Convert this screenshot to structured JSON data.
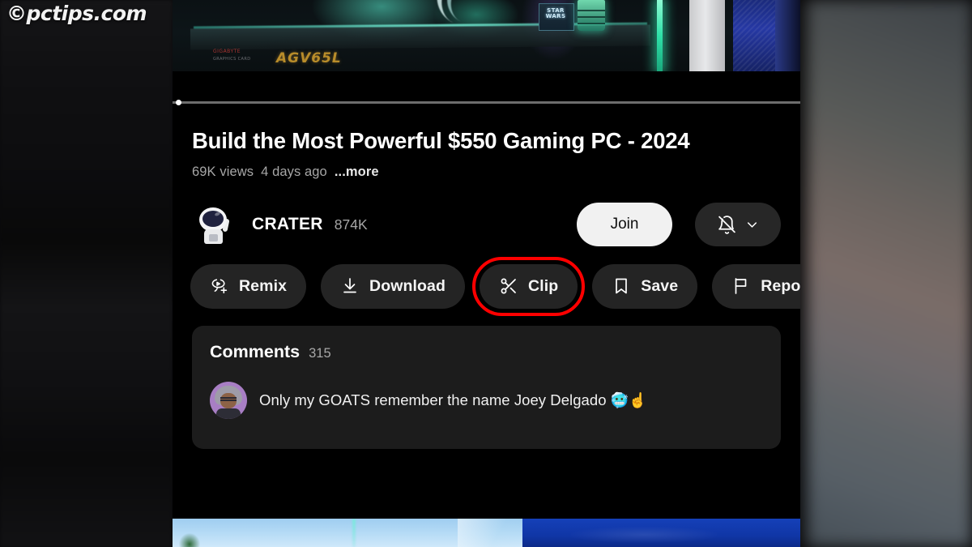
{
  "watermark": {
    "text": "©pctips.com"
  },
  "player": {
    "scrubber": {
      "name": "video-progress-bar",
      "position_percent": 1
    },
    "frame": {
      "gpu_brand": "GIGABYTE",
      "gpu_sub": "GRAPHICS CARD",
      "gpu_model": "AGV65L",
      "box_label": "STAR WARS"
    }
  },
  "video": {
    "title": "Build the Most Powerful $550 Gaming PC - 2024",
    "views": "69K views",
    "published": "4 days ago",
    "more_label": "...more"
  },
  "channel": {
    "avatar_name": "astronaut-avatar",
    "name": "CRATER",
    "subscribers": "874K",
    "join_label": "Join",
    "bell_icon": "bell-off-icon",
    "chevron_icon": "chevron-down-icon"
  },
  "actions": [
    {
      "id": "remix",
      "label": "Remix",
      "icon": "remix-icon",
      "highlighted": false
    },
    {
      "id": "download",
      "label": "Download",
      "icon": "download-icon",
      "highlighted": false
    },
    {
      "id": "clip",
      "label": "Clip",
      "icon": "scissors-icon",
      "highlighted": true
    },
    {
      "id": "save",
      "label": "Save",
      "icon": "bookmark-icon",
      "highlighted": false
    },
    {
      "id": "report",
      "label": "Report",
      "icon": "flag-icon",
      "highlighted": false
    }
  ],
  "comments": {
    "title": "Comments",
    "count": "315",
    "top_comment": {
      "avatar_name": "commenter-avatar",
      "text": "Only my GOATS remember the name Joey Delgado",
      "emoji": "🥶☝️"
    }
  },
  "colors": {
    "highlight": "#ff0000",
    "panel_background": "#000000",
    "button_background": "#242424",
    "join_background": "#f1f1f1",
    "card_background": "#1c1c1c",
    "secondary_text": "#a7a7a7"
  }
}
